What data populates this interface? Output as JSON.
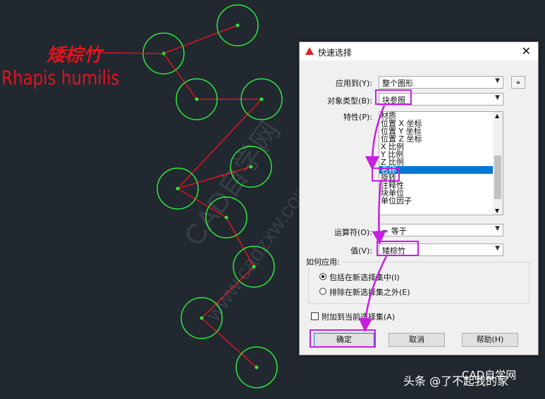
{
  "annotation": {
    "chinese_name": "矮棕竹",
    "latin_name": "Rhapis humilis"
  },
  "watermarks": [
    "CAD自学网",
    "www.cadzxw.com"
  ],
  "dialog": {
    "title": "快速选择",
    "close_glyph": "✕",
    "apply_to": {
      "label": "应用到(Y):",
      "value": "整个图形"
    },
    "object_type": {
      "label": "对象类型(B):",
      "value": "块参照"
    },
    "properties": {
      "label": "特性(P):",
      "items": [
        "材质",
        "位置 X 坐标",
        "位置 Y 坐标",
        "位置 Z 坐标",
        "X 比例",
        "Y 比例",
        "Z 比例",
        "名称",
        "旋转",
        "注释性",
        "块单位",
        "单位因子"
      ],
      "selected": "名称"
    },
    "operator": {
      "label": "运算符(O):",
      "value": "= 等于"
    },
    "value": {
      "label": "值(V):",
      "value": "矮棕竹"
    },
    "how_to_apply": {
      "title": "如何应用:",
      "option_include": "包括在新选择集中(I)",
      "option_exclude": "排除在新选择集之外(E)",
      "selected": "include"
    },
    "append": {
      "label": "附加到当前选择集(A)",
      "checked": false
    },
    "buttons": {
      "ok": "确定",
      "cancel": "取消",
      "help": "帮助(H)"
    }
  },
  "footer": {
    "source": "头条",
    "account": "@了不起我的家",
    "logo_text": "CAD自学网"
  },
  "colors": {
    "background": "#212830",
    "circle": "#2ee83c",
    "polyline": "#e0141c",
    "highlight": "#c71fe0"
  }
}
